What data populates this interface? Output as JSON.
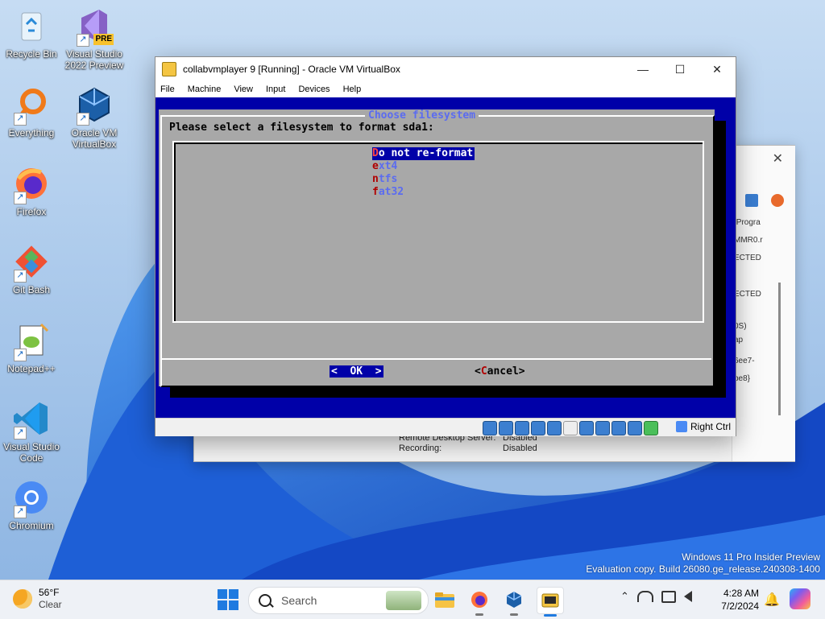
{
  "desktop": {
    "icons": [
      {
        "label_line1": "Recycle Bin",
        "label_line2": "",
        "icon": "recycle-bin-icon"
      },
      {
        "label_line1": "Visual Studio",
        "label_line2": "2022 Preview",
        "icon": "visual-studio-preview-icon",
        "badge": "PRE"
      },
      {
        "label_line1": "Everything",
        "label_line2": "",
        "icon": "everything-search-icon"
      },
      {
        "label_line1": "Oracle VM",
        "label_line2": "VirtualBox",
        "icon": "virtualbox-icon"
      },
      {
        "label_line1": "Firefox",
        "label_line2": "",
        "icon": "firefox-icon"
      },
      {
        "label_line1": "Git Bash",
        "label_line2": "",
        "icon": "git-bash-icon"
      },
      {
        "label_line1": "Notepad++",
        "label_line2": "",
        "icon": "notepadpp-icon"
      },
      {
        "label_line1": "Visual Studio",
        "label_line2": "Code",
        "icon": "vscode-icon"
      },
      {
        "label_line1": "Chromium",
        "label_line2": "",
        "icon": "chromium-icon"
      }
    ]
  },
  "bg_window": {
    "close_glyph": "✕",
    "side_texts": [
      "\\Progra",
      "MMR0.r",
      "ECTED",
      "ECTED",
      "0S)",
      "ap",
      "6ee7-",
      "be8}"
    ],
    "info_rows": [
      {
        "label": "Remote Desktop Server:",
        "value": "Disabled"
      },
      {
        "label": "Recording:",
        "value": "Disabled"
      }
    ]
  },
  "vm_window": {
    "title": "collabvmplayer 9 [Running] - Oracle VM VirtualBox",
    "controls": {
      "minimize": "—",
      "maximize": "☐",
      "close": "✕"
    },
    "menu": [
      "File",
      "Machine",
      "View",
      "Input",
      "Devices",
      "Help"
    ],
    "status_right": "Right Ctrl"
  },
  "dialog": {
    "title": "Choose filesystem",
    "prompt": "Please select a filesystem to format sda1:",
    "options": [
      {
        "hotkey": "D",
        "rest": "o not re-format",
        "selected": true
      },
      {
        "hotkey": "e",
        "rest": "xt4",
        "selected": false
      },
      {
        "hotkey": "n",
        "rest": "tfs",
        "selected": false
      },
      {
        "hotkey": "f",
        "rest": "at32",
        "selected": false
      }
    ],
    "ok_button": "<  OK  >",
    "cancel_left": "<",
    "cancel_hotkey": "C",
    "cancel_rest": "ancel>"
  },
  "watermark": {
    "line1": "Windows 11 Pro Insider Preview",
    "line2": "Evaluation copy. Build 26080.ge_release.240308-1400"
  },
  "taskbar": {
    "weather_temp": "56°F",
    "weather_cond": "Clear",
    "search_placeholder": "Search",
    "clock_time": "4:28 AM",
    "clock_date": "7/2/2024",
    "tray_up_glyph": "⌃",
    "apps": [
      "file-explorer-icon",
      "firefox-icon",
      "virtualbox-icon",
      "collabvm-icon"
    ]
  },
  "colors": {
    "vm_blue": "#0000a8",
    "dialog_gray": "#a8a8a8",
    "title_blue": "#5b6cf0",
    "hotkey_red": "#b00000"
  }
}
